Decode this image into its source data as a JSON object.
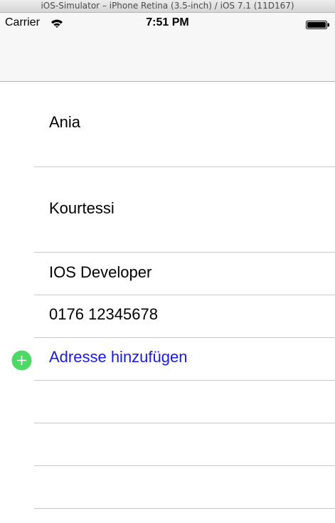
{
  "window": {
    "title": "iOS-Simulator – iPhone Retina (3.5-inch) / iOS 7.1 (11D167)"
  },
  "status_bar": {
    "carrier": "Carrier",
    "time": "7:51 PM",
    "icons": [
      "wifi-icon",
      "battery-icon"
    ]
  },
  "form": {
    "first_name": "Ania",
    "last_name": "Kourtessi",
    "job_title": "IOS Developer",
    "phone": "0176 12345678",
    "add_address_label": "Adresse hinzufügen",
    "add_icon": "add-circle-icon"
  },
  "colors": {
    "link_blue": "#1a1ae6",
    "add_green": "#4cd964",
    "separator": "#c8c7cc",
    "bar_background": "#f7f7f7"
  }
}
